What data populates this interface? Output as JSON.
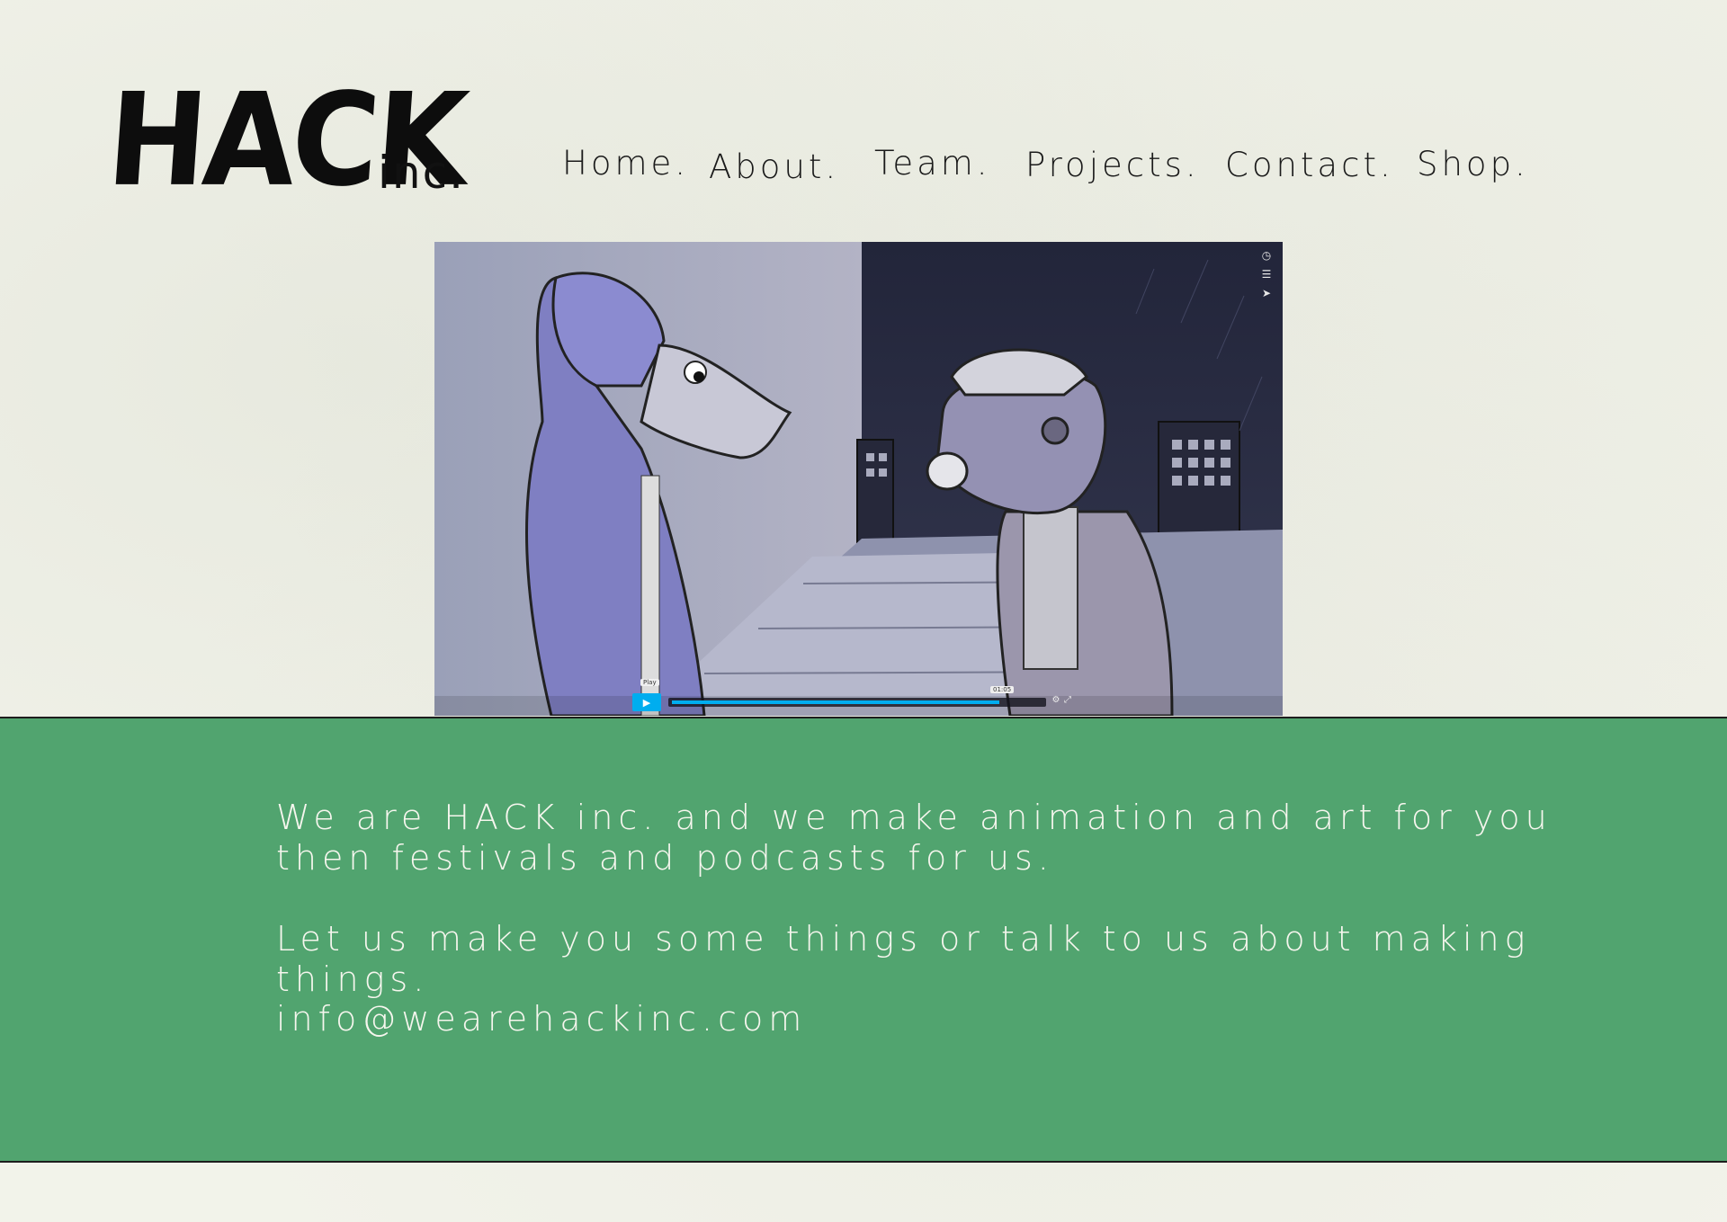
{
  "header": {
    "logo": {
      "text": "HACK",
      "suffix": "inc."
    },
    "nav": [
      "Home.",
      "About.",
      "Team.",
      "Projects.",
      "Contact.",
      "Shop."
    ]
  },
  "video": {
    "side_controls": [
      "clock-icon",
      "layers-icon",
      "send-icon"
    ],
    "play_tooltip": "Play",
    "time_tooltip": "01:05",
    "progress": 0.96,
    "colors": {
      "accent": "#00adef"
    }
  },
  "intro": {
    "paragraph1": "We are HACK inc. and we make animation and art for you then festivals and podcasts for us.",
    "paragraph2": "Let us make you some things or talk to us about making things.",
    "email": "info@wearehackinc.com"
  },
  "colors": {
    "page_background": "#f2f3ea",
    "panel_green": "#51a46f",
    "panel_text": "#f6f6ee",
    "nav_text": "#1a1a1a"
  }
}
